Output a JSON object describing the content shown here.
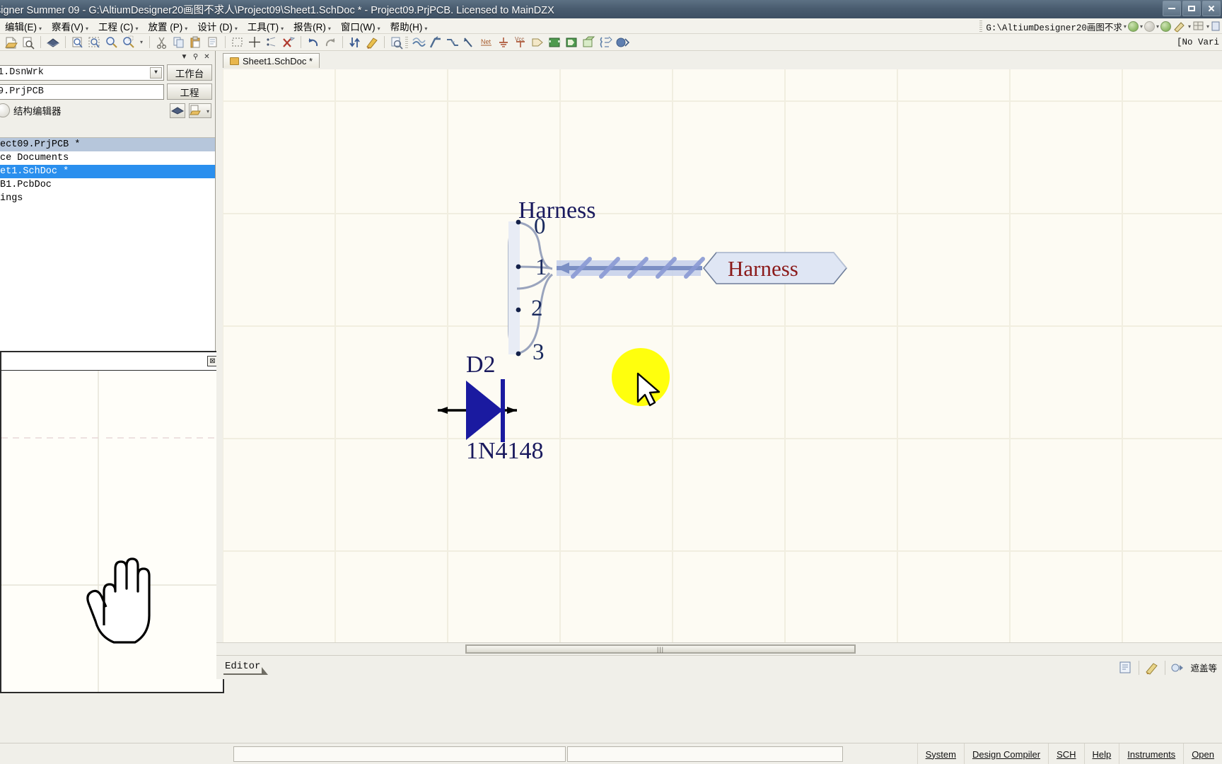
{
  "titlebar": {
    "text": "signer Summer 09 - G:\\AltiumDesigner20画图不求人\\Project09\\Sheet1.SchDoc * - Project09.PrjPCB. Licensed to MainDZX",
    "minimize": "minimize-button",
    "maximize": "maximize-button",
    "close": "close-button"
  },
  "menu": {
    "items": [
      {
        "label": "编辑(E)",
        "name": "menu-edit"
      },
      {
        "label": "察看(V)",
        "name": "menu-view"
      },
      {
        "label": "工程 (C)",
        "name": "menu-project"
      },
      {
        "label": "放置 (P)",
        "name": "menu-place"
      },
      {
        "label": "设计 (D)",
        "name": "menu-design"
      },
      {
        "label": "工具(T)",
        "name": "menu-tools"
      },
      {
        "label": "报告(R)",
        "name": "menu-reports"
      },
      {
        "label": "窗口(W)",
        "name": "menu-window"
      },
      {
        "label": "帮助(H)",
        "name": "menu-help"
      }
    ],
    "caret": "▾",
    "path_value": "G:\\AltiumDesigner20画图不求",
    "no_variations": "[No Vari"
  },
  "left_panel": {
    "workspace_value": "1.DsnWrk",
    "workspace_button": "工作台",
    "project_value": "9.PrjPCB",
    "project_button": "工程",
    "structure_editor": "结构编辑器",
    "tree": [
      {
        "label": "ect09.PrjPCB *",
        "state": "selected-gray",
        "name": "tree-item-project"
      },
      {
        "label": "ce Documents",
        "state": "normal",
        "name": "tree-item-source-documents"
      },
      {
        "label": "et1.SchDoc *",
        "state": "selected-blue",
        "name": "tree-item-sheet1-schdoc"
      },
      {
        "label": "B1.PcbDoc",
        "state": "normal",
        "name": "tree-item-pcbdoc"
      },
      {
        "label": "ings",
        "state": "normal",
        "name": "tree-item-settings"
      }
    ]
  },
  "tabstrip": {
    "doc_tab": "Sheet1.SchDoc *"
  },
  "schematic": {
    "harness_title": "Harness",
    "harness_entries": [
      "0",
      "1",
      "2",
      "3"
    ],
    "harness_label": "Harness",
    "diode_designator": "D2",
    "diode_part": "1N4148",
    "colors": {
      "harness_text": "#1a1a5e",
      "harness_label_text": "#8b1a1a",
      "harness_bus": "#8a9ad4",
      "diode_body": "#1a1aa0",
      "grid": "#f2efe2",
      "background": "#fdfbf3",
      "highlight": "#ffff00"
    }
  },
  "hscroll": {
    "thumb_grip": "|||"
  },
  "editorbar": {
    "tab_label": "Editor",
    "right_text": "遮盖等"
  },
  "statusbar": {
    "cells": [
      {
        "label": "System",
        "name": "status-system"
      },
      {
        "label": "Design Compiler",
        "name": "status-design-compiler"
      },
      {
        "label": "SCH",
        "name": "status-sch"
      },
      {
        "label": "Help",
        "name": "status-help"
      },
      {
        "label": "Instruments",
        "name": "status-instruments"
      },
      {
        "label": "Open",
        "name": "status-open"
      }
    ]
  }
}
